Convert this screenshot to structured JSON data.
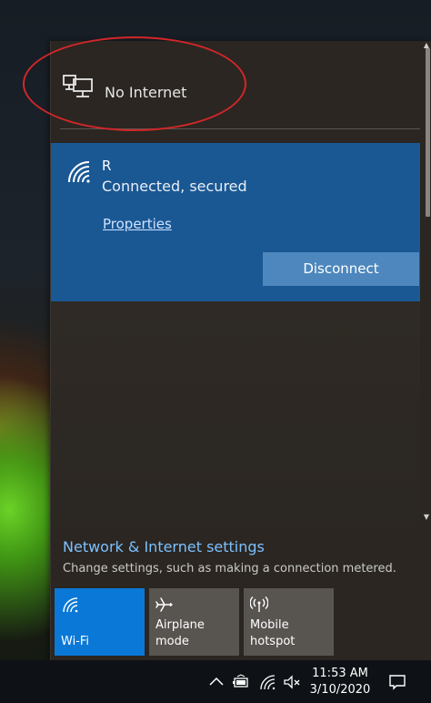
{
  "status": {
    "icon": "ethernet-network-icon",
    "label": "No Internet"
  },
  "network": {
    "icon": "wifi-signal-icon",
    "ssid": "R",
    "status": "Connected, secured",
    "properties_label": "Properties",
    "disconnect_label": "Disconnect"
  },
  "settings": {
    "title": "Network & Internet settings",
    "subtitle": "Change settings, such as making a connection metered."
  },
  "quick_actions": [
    {
      "icon": "wifi-icon",
      "label": "Wi-Fi",
      "active": true
    },
    {
      "icon": "airplane-icon",
      "label": "Airplane mode",
      "active": false
    },
    {
      "icon": "hotspot-icon",
      "label": "Mobile hotspot",
      "active": false
    }
  ],
  "taskbar": {
    "icons": [
      "chevron-up-icon",
      "battery-icon",
      "wifi-tray-icon",
      "volume-muted-icon",
      "action-center-icon"
    ],
    "time": "11:53 AM",
    "date": "3/10/2020"
  },
  "colors": {
    "accent": "#0a78d7",
    "connected_panel": "#1a5894",
    "link": "#7cc0ff",
    "annotation": "#d2262a"
  }
}
